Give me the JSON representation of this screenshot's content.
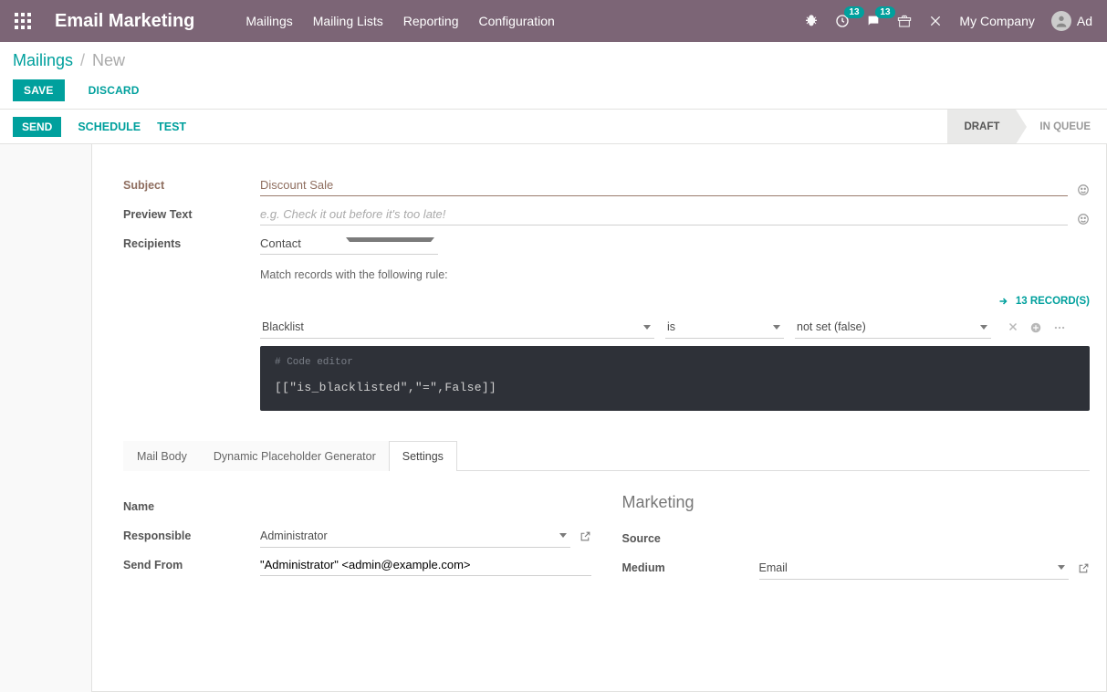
{
  "nav": {
    "brand": "Email Marketing",
    "menu": [
      "Mailings",
      "Mailing Lists",
      "Reporting",
      "Configuration"
    ],
    "badge1": "13",
    "badge2": "13",
    "company": "My Company",
    "user_initials": "Ad"
  },
  "breadcrumb": {
    "parent": "Mailings",
    "sep": "/",
    "current": "New"
  },
  "actions": {
    "save": "SAVE",
    "discard": "DISCARD"
  },
  "status": {
    "send": "SEND",
    "schedule": "SCHEDULE",
    "test": "TEST",
    "stage_draft": "DRAFT",
    "stage_queue": "IN QUEUE"
  },
  "form": {
    "subject_label": "Subject",
    "subject_value": "Discount Sale",
    "preview_label": "Preview Text",
    "preview_placeholder": "e.g. Check it out before it's too late!",
    "recipients_label": "Recipients",
    "recipients_value": "Contact",
    "rule_help": "Match records with the following rule:",
    "domain": {
      "field": "Blacklist",
      "operator": "is",
      "value": "not set (false)"
    },
    "records": "13 RECORD(S)",
    "code_comment": "# Code editor",
    "code": "[[\"is_blacklisted\",\"=\",False]]"
  },
  "tabs": {
    "body": "Mail Body",
    "dyn": "Dynamic Placeholder Generator",
    "settings": "Settings"
  },
  "settings": {
    "name_label": "Name",
    "responsible_label": "Responsible",
    "responsible_value": "Administrator",
    "sendfrom_label": "Send From",
    "sendfrom_value": "\"Administrator\" <admin@example.com>",
    "marketing_title": "Marketing",
    "source_label": "Source",
    "medium_label": "Medium",
    "medium_value": "Email"
  }
}
